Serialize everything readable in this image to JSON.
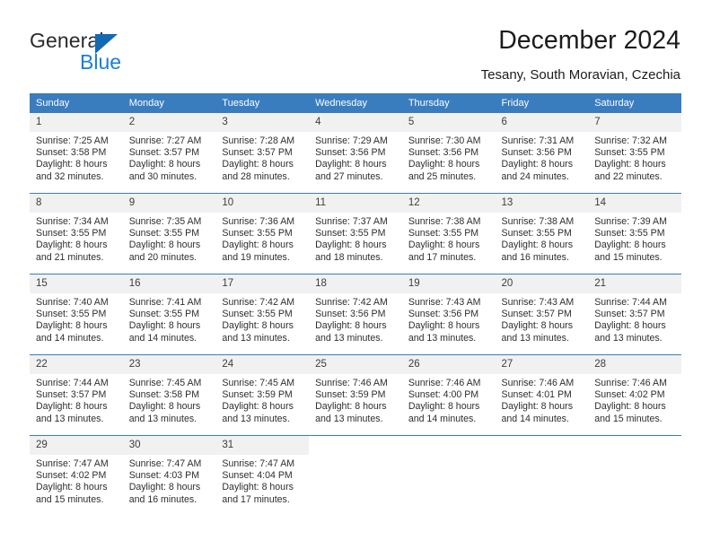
{
  "logo": {
    "word1": "General",
    "word2": "Blue",
    "triangle_color": "#1369b4",
    "word2_color": "#1a7fd4"
  },
  "header": {
    "title": "December 2024",
    "subtitle": "Tesany, South Moravian, Czechia"
  },
  "calendar": {
    "accent_color": "#3a7dbf",
    "daynum_bg": "#f1f1f1",
    "weekday_headers": [
      "Sunday",
      "Monday",
      "Tuesday",
      "Wednesday",
      "Thursday",
      "Friday",
      "Saturday"
    ],
    "weeks": [
      [
        {
          "day": "1",
          "sunrise": "Sunrise: 7:25 AM",
          "sunset": "Sunset: 3:58 PM",
          "daylight1": "Daylight: 8 hours",
          "daylight2": "and 32 minutes."
        },
        {
          "day": "2",
          "sunrise": "Sunrise: 7:27 AM",
          "sunset": "Sunset: 3:57 PM",
          "daylight1": "Daylight: 8 hours",
          "daylight2": "and 30 minutes."
        },
        {
          "day": "3",
          "sunrise": "Sunrise: 7:28 AM",
          "sunset": "Sunset: 3:57 PM",
          "daylight1": "Daylight: 8 hours",
          "daylight2": "and 28 minutes."
        },
        {
          "day": "4",
          "sunrise": "Sunrise: 7:29 AM",
          "sunset": "Sunset: 3:56 PM",
          "daylight1": "Daylight: 8 hours",
          "daylight2": "and 27 minutes."
        },
        {
          "day": "5",
          "sunrise": "Sunrise: 7:30 AM",
          "sunset": "Sunset: 3:56 PM",
          "daylight1": "Daylight: 8 hours",
          "daylight2": "and 25 minutes."
        },
        {
          "day": "6",
          "sunrise": "Sunrise: 7:31 AM",
          "sunset": "Sunset: 3:56 PM",
          "daylight1": "Daylight: 8 hours",
          "daylight2": "and 24 minutes."
        },
        {
          "day": "7",
          "sunrise": "Sunrise: 7:32 AM",
          "sunset": "Sunset: 3:55 PM",
          "daylight1": "Daylight: 8 hours",
          "daylight2": "and 22 minutes."
        }
      ],
      [
        {
          "day": "8",
          "sunrise": "Sunrise: 7:34 AM",
          "sunset": "Sunset: 3:55 PM",
          "daylight1": "Daylight: 8 hours",
          "daylight2": "and 21 minutes."
        },
        {
          "day": "9",
          "sunrise": "Sunrise: 7:35 AM",
          "sunset": "Sunset: 3:55 PM",
          "daylight1": "Daylight: 8 hours",
          "daylight2": "and 20 minutes."
        },
        {
          "day": "10",
          "sunrise": "Sunrise: 7:36 AM",
          "sunset": "Sunset: 3:55 PM",
          "daylight1": "Daylight: 8 hours",
          "daylight2": "and 19 minutes."
        },
        {
          "day": "11",
          "sunrise": "Sunrise: 7:37 AM",
          "sunset": "Sunset: 3:55 PM",
          "daylight1": "Daylight: 8 hours",
          "daylight2": "and 18 minutes."
        },
        {
          "day": "12",
          "sunrise": "Sunrise: 7:38 AM",
          "sunset": "Sunset: 3:55 PM",
          "daylight1": "Daylight: 8 hours",
          "daylight2": "and 17 minutes."
        },
        {
          "day": "13",
          "sunrise": "Sunrise: 7:38 AM",
          "sunset": "Sunset: 3:55 PM",
          "daylight1": "Daylight: 8 hours",
          "daylight2": "and 16 minutes."
        },
        {
          "day": "14",
          "sunrise": "Sunrise: 7:39 AM",
          "sunset": "Sunset: 3:55 PM",
          "daylight1": "Daylight: 8 hours",
          "daylight2": "and 15 minutes."
        }
      ],
      [
        {
          "day": "15",
          "sunrise": "Sunrise: 7:40 AM",
          "sunset": "Sunset: 3:55 PM",
          "daylight1": "Daylight: 8 hours",
          "daylight2": "and 14 minutes."
        },
        {
          "day": "16",
          "sunrise": "Sunrise: 7:41 AM",
          "sunset": "Sunset: 3:55 PM",
          "daylight1": "Daylight: 8 hours",
          "daylight2": "and 14 minutes."
        },
        {
          "day": "17",
          "sunrise": "Sunrise: 7:42 AM",
          "sunset": "Sunset: 3:55 PM",
          "daylight1": "Daylight: 8 hours",
          "daylight2": "and 13 minutes."
        },
        {
          "day": "18",
          "sunrise": "Sunrise: 7:42 AM",
          "sunset": "Sunset: 3:56 PM",
          "daylight1": "Daylight: 8 hours",
          "daylight2": "and 13 minutes."
        },
        {
          "day": "19",
          "sunrise": "Sunrise: 7:43 AM",
          "sunset": "Sunset: 3:56 PM",
          "daylight1": "Daylight: 8 hours",
          "daylight2": "and 13 minutes."
        },
        {
          "day": "20",
          "sunrise": "Sunrise: 7:43 AM",
          "sunset": "Sunset: 3:57 PM",
          "daylight1": "Daylight: 8 hours",
          "daylight2": "and 13 minutes."
        },
        {
          "day": "21",
          "sunrise": "Sunrise: 7:44 AM",
          "sunset": "Sunset: 3:57 PM",
          "daylight1": "Daylight: 8 hours",
          "daylight2": "and 13 minutes."
        }
      ],
      [
        {
          "day": "22",
          "sunrise": "Sunrise: 7:44 AM",
          "sunset": "Sunset: 3:57 PM",
          "daylight1": "Daylight: 8 hours",
          "daylight2": "and 13 minutes."
        },
        {
          "day": "23",
          "sunrise": "Sunrise: 7:45 AM",
          "sunset": "Sunset: 3:58 PM",
          "daylight1": "Daylight: 8 hours",
          "daylight2": "and 13 minutes."
        },
        {
          "day": "24",
          "sunrise": "Sunrise: 7:45 AM",
          "sunset": "Sunset: 3:59 PM",
          "daylight1": "Daylight: 8 hours",
          "daylight2": "and 13 minutes."
        },
        {
          "day": "25",
          "sunrise": "Sunrise: 7:46 AM",
          "sunset": "Sunset: 3:59 PM",
          "daylight1": "Daylight: 8 hours",
          "daylight2": "and 13 minutes."
        },
        {
          "day": "26",
          "sunrise": "Sunrise: 7:46 AM",
          "sunset": "Sunset: 4:00 PM",
          "daylight1": "Daylight: 8 hours",
          "daylight2": "and 14 minutes."
        },
        {
          "day": "27",
          "sunrise": "Sunrise: 7:46 AM",
          "sunset": "Sunset: 4:01 PM",
          "daylight1": "Daylight: 8 hours",
          "daylight2": "and 14 minutes."
        },
        {
          "day": "28",
          "sunrise": "Sunrise: 7:46 AM",
          "sunset": "Sunset: 4:02 PM",
          "daylight1": "Daylight: 8 hours",
          "daylight2": "and 15 minutes."
        }
      ],
      [
        {
          "day": "29",
          "sunrise": "Sunrise: 7:47 AM",
          "sunset": "Sunset: 4:02 PM",
          "daylight1": "Daylight: 8 hours",
          "daylight2": "and 15 minutes."
        },
        {
          "day": "30",
          "sunrise": "Sunrise: 7:47 AM",
          "sunset": "Sunset: 4:03 PM",
          "daylight1": "Daylight: 8 hours",
          "daylight2": "and 16 minutes."
        },
        {
          "day": "31",
          "sunrise": "Sunrise: 7:47 AM",
          "sunset": "Sunset: 4:04 PM",
          "daylight1": "Daylight: 8 hours",
          "daylight2": "and 17 minutes."
        },
        {
          "day": "",
          "sunrise": "",
          "sunset": "",
          "daylight1": "",
          "daylight2": ""
        },
        {
          "day": "",
          "sunrise": "",
          "sunset": "",
          "daylight1": "",
          "daylight2": ""
        },
        {
          "day": "",
          "sunrise": "",
          "sunset": "",
          "daylight1": "",
          "daylight2": ""
        },
        {
          "day": "",
          "sunrise": "",
          "sunset": "",
          "daylight1": "",
          "daylight2": ""
        }
      ]
    ]
  }
}
